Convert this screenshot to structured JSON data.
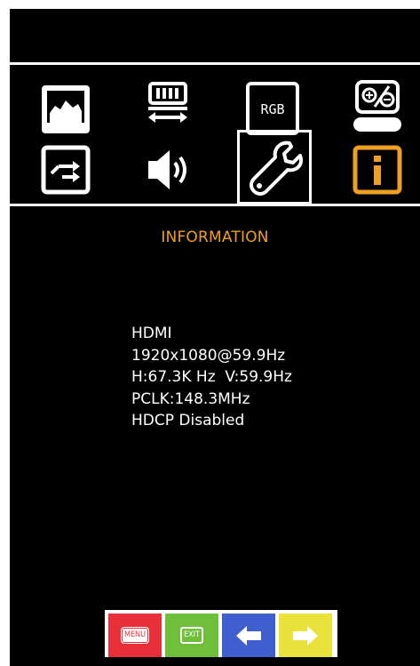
{
  "menu": {
    "icons": [
      {
        "name": "picture-icon"
      },
      {
        "name": "display-settings-icon"
      },
      {
        "name": "rgb-icon",
        "label": "RGB"
      },
      {
        "name": "picture-adjust-icon"
      },
      {
        "name": "input-source-icon"
      },
      {
        "name": "audio-icon"
      },
      {
        "name": "setup-wrench-icon",
        "selected": true
      },
      {
        "name": "information-icon",
        "active": true
      }
    ],
    "accent_color": "#f0a020"
  },
  "page": {
    "title": "INFORMATION",
    "info_lines": [
      "HDMI",
      "1920x1080@59.9Hz",
      "H:67.3K Hz  V:59.9Hz",
      "PCLK:148.3MHz",
      "HDCP Disabled"
    ]
  },
  "buttons": {
    "menu_label": "MENU",
    "exit_label": "EXIT",
    "menu_color": "#e8303a",
    "exit_color": "#6fbf3a",
    "left_color": "#3f5fcf",
    "right_color": "#e8e23a"
  }
}
